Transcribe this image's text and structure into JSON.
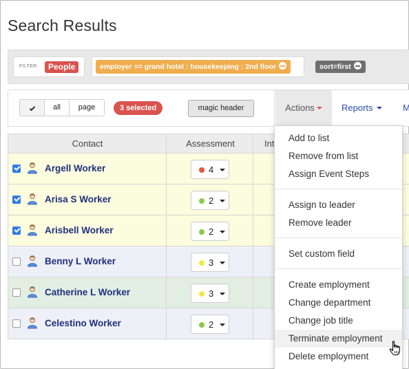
{
  "page": {
    "title": "Search Results"
  },
  "filter_bar": {
    "label": "FILTER:",
    "type_tag": "People",
    "employer_filter": "employer == grand hotel : housekeeping : 2nd floor",
    "sort_tag": "sort=first"
  },
  "toolbar": {
    "select_all": "all",
    "select_page": "page",
    "selected_count": "3 selected",
    "magic_header": "magic header",
    "actions": "Actions",
    "reports": "Reports",
    "more": "M"
  },
  "table": {
    "columns": [
      "Contact",
      "Assessment",
      "Int"
    ],
    "rows": [
      {
        "name": "Argell Worker",
        "checked": true,
        "assessment": "4",
        "dot_color": "#e8583e",
        "row_color": "#fcfcde"
      },
      {
        "name": "Arisa S Worker",
        "checked": true,
        "assessment": "2",
        "dot_color": "#8cc94a",
        "row_color": "#fcfcde"
      },
      {
        "name": "Arisbell Worker",
        "checked": true,
        "assessment": "2",
        "dot_color": "#8cc94a",
        "row_color": "#fcfcde"
      },
      {
        "name": "Benny L Worker",
        "checked": false,
        "assessment": "3",
        "dot_color": "#eeea47",
        "row_color": "#eef0f8"
      },
      {
        "name": "Catherine L Worker",
        "checked": false,
        "assessment": "3",
        "dot_color": "#eeea47",
        "row_color": "#e3eee3"
      },
      {
        "name": "Celestino Worker",
        "checked": false,
        "assessment": "2",
        "dot_color": "#8cc94a",
        "row_color": "#eef0f8"
      }
    ]
  },
  "actions_menu": {
    "groups": [
      [
        "Add to list",
        "Remove from list",
        "Assign Event Steps"
      ],
      [
        "Assign to leader",
        "Remove leader"
      ],
      [
        "Set custom field"
      ],
      [
        "Create employment",
        "Change department",
        "Change job title",
        "Terminate employment",
        "Delete employment"
      ]
    ],
    "hovered": "Terminate employment"
  }
}
